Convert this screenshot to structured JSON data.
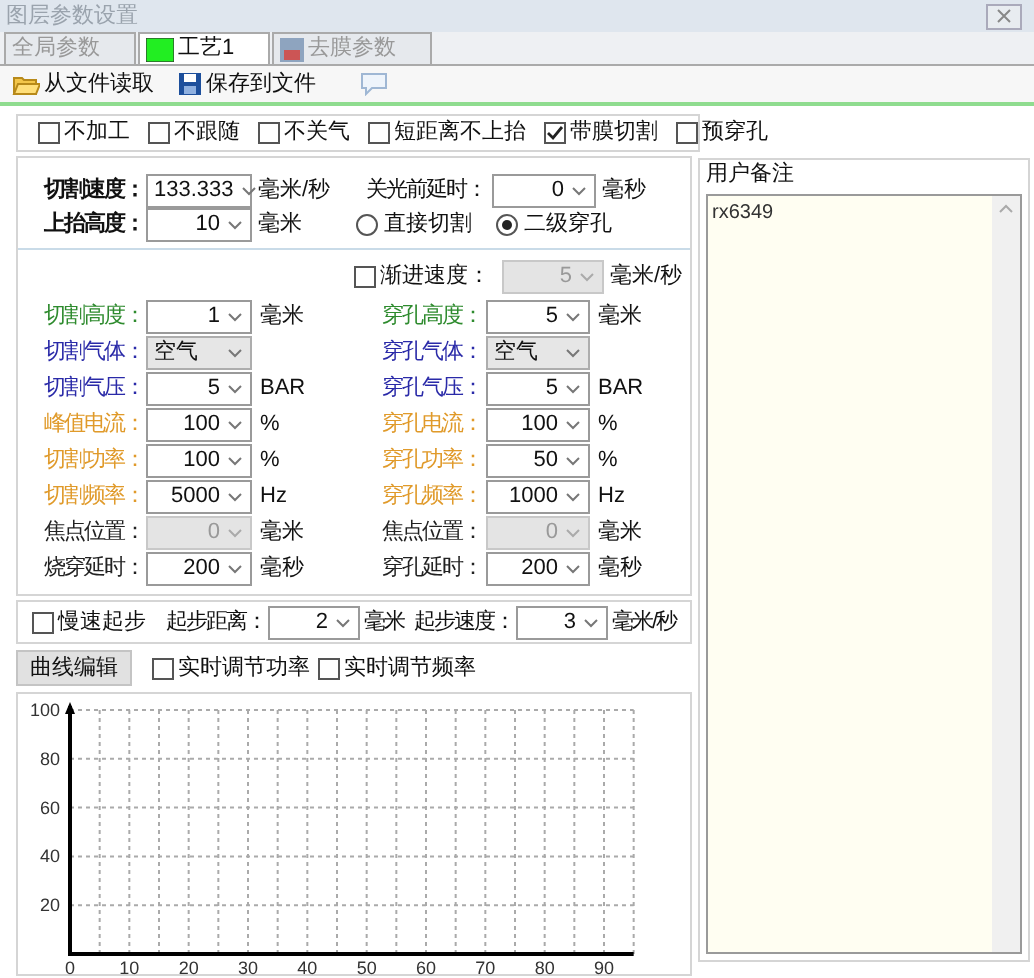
{
  "window": {
    "title": "图层参数设置"
  },
  "tabs": [
    {
      "label": "全局参数",
      "selected": false,
      "kind": "plain"
    },
    {
      "label": "工艺1",
      "selected": true,
      "kind": "swatch"
    },
    {
      "label": "去膜参数",
      "selected": false,
      "kind": "image"
    }
  ],
  "toolbar": [
    {
      "label": "从文件读取",
      "kind": "open"
    },
    {
      "label": "保存到文件",
      "kind": "save"
    },
    {
      "kind": "note"
    }
  ],
  "options": [
    {
      "label": "不加工",
      "checked": false
    },
    {
      "label": "不跟随",
      "checked": false
    },
    {
      "label": "不关气",
      "checked": false
    },
    {
      "label": "短距离不上抬",
      "checked": false
    },
    {
      "label": "带膜切割",
      "checked": true
    },
    {
      "label": "预穿孔",
      "checked": false
    }
  ],
  "cutting": {
    "cut_speed": {
      "label": "切割速度：",
      "value": "133.333",
      "unit": "毫米/秒"
    },
    "laser_off_delay": {
      "label": "关光前延时：",
      "value": "0",
      "unit": "毫秒"
    },
    "lift_height": {
      "label": "上抬高度：",
      "value": "10",
      "unit": "毫米"
    },
    "pierce_mode": [
      {
        "label": "直接切割",
        "selected": false
      },
      {
        "label": "二级穿孔",
        "selected": true
      }
    ]
  },
  "progressive": {
    "label": "渐进速度：",
    "checked": false,
    "value": "5",
    "unit": "毫米/秒",
    "disabled": true
  },
  "params": [
    {
      "left": {
        "label": "切割高度：",
        "value": "1",
        "unit": "毫米",
        "kind": "combo",
        "color": "#2e8b2e",
        "disabled": false
      },
      "right": {
        "label": "穿孔高度：",
        "value": "5",
        "unit": "毫米",
        "kind": "combo",
        "color": "#2e8b2e",
        "disabled": false
      }
    },
    {
      "left": {
        "label": "切割气体：",
        "value": "空气",
        "kind": "select",
        "color": "#2a2aa8",
        "disabled": false
      },
      "right": {
        "label": "穿孔气体：",
        "value": "空气",
        "kind": "select",
        "color": "#2a2aa8",
        "disabled": false
      }
    },
    {
      "left": {
        "label": "切割气压：",
        "value": "5",
        "unit": "BAR",
        "kind": "combo",
        "color": "#2a2aa8",
        "disabled": false
      },
      "right": {
        "label": "穿孔气压：",
        "value": "5",
        "unit": "BAR",
        "kind": "combo",
        "color": "#2a2aa8",
        "disabled": false
      }
    },
    {
      "left": {
        "label": "峰值电流：",
        "value": "100",
        "unit": "%",
        "kind": "combo",
        "color": "#e09a2a",
        "disabled": false
      },
      "right": {
        "label": "穿孔电流：",
        "value": "100",
        "unit": "%",
        "kind": "combo",
        "color": "#e09a2a",
        "disabled": false
      }
    },
    {
      "left": {
        "label": "切割功率：",
        "value": "100",
        "unit": "%",
        "kind": "combo",
        "color": "#e09a2a",
        "disabled": false
      },
      "right": {
        "label": "穿孔功率：",
        "value": "50",
        "unit": "%",
        "kind": "combo",
        "color": "#e09a2a",
        "disabled": false
      }
    },
    {
      "left": {
        "label": "切割频率：",
        "value": "5000",
        "unit": "Hz",
        "kind": "combo",
        "color": "#e09a2a",
        "disabled": false
      },
      "right": {
        "label": "穿孔频率：",
        "value": "1000",
        "unit": "Hz",
        "kind": "combo",
        "color": "#e09a2a",
        "disabled": false
      }
    },
    {
      "left": {
        "label": "焦点位置：",
        "value": "0",
        "unit": "毫米",
        "kind": "combo",
        "color": "#222222",
        "disabled": true
      },
      "right": {
        "label": "焦点位置：",
        "value": "0",
        "unit": "毫米",
        "kind": "combo",
        "color": "#222222",
        "disabled": true
      }
    },
    {
      "left": {
        "label": "烧穿延时：",
        "value": "200",
        "unit": "毫秒",
        "kind": "combo",
        "color": "#222222",
        "disabled": false
      },
      "right": {
        "label": "穿孔延时：",
        "value": "200",
        "unit": "毫秒",
        "kind": "combo",
        "color": "#222222",
        "disabled": false
      }
    }
  ],
  "slow_start": {
    "label": "慢速起步",
    "checked": false,
    "fields": [
      {
        "label": "起步距离：",
        "value": "2",
        "unit": "毫米"
      },
      {
        "label": "起步速度：",
        "value": "3",
        "unit": "毫米/秒"
      }
    ]
  },
  "curve": {
    "button": "曲线编辑",
    "options": [
      {
        "label": "实时调节功率",
        "checked": false
      },
      {
        "label": "实时调节频率",
        "checked": false
      }
    ],
    "chart_data": {
      "type": "line",
      "grid": true,
      "xlim": [
        0,
        95
      ],
      "ylim": [
        0,
        100
      ],
      "xticks": [
        0,
        10,
        20,
        30,
        40,
        50,
        60,
        70,
        80,
        90
      ],
      "yticks": [
        20,
        40,
        60,
        80,
        100
      ]
    }
  },
  "notes": {
    "title": "用户备注",
    "value": "rx6349"
  }
}
